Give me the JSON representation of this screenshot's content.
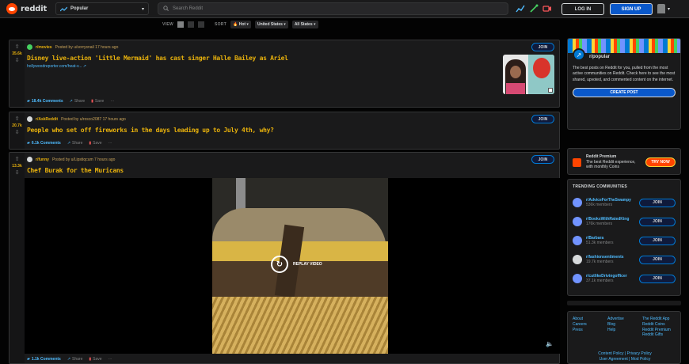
{
  "header": {
    "logo_text": "reddit",
    "feed": "Popular",
    "search_placeholder": "Search Reddit",
    "login_label": "LOG IN",
    "signup_label": "SIGN UP"
  },
  "sortbar": {
    "view_label": "VIEW",
    "sort_label": "SORT",
    "sort_value": "Hot",
    "country": "United States",
    "region": "All States"
  },
  "posts": [
    {
      "score": "35.6k",
      "subreddit": "r/movies",
      "posted_by": "Posted by u/sorrysnail 17 hours ago",
      "title": "Disney live-action 'Little Mermaid' has cast singer Halle Bailey as Ariel",
      "link": "hollywoodreporter.com/heat-v... ↗",
      "comments": "18.4k Comments",
      "share": "Share",
      "save": "Save",
      "join": "JOIN"
    },
    {
      "score": "20.7k",
      "subreddit": "r/AskReddit",
      "posted_by": "Posted by u/rosco2087 17 hours ago",
      "title": "People who set off fireworks in the days leading up to July 4th, why?",
      "comments": "6.1k Comments",
      "share": "Share",
      "save": "Save",
      "join": "JOIN"
    },
    {
      "score": "13.3k",
      "subreddit": "r/funny",
      "posted_by": "Posted by u/Lipstiqcum 7 hours ago",
      "title": "Chef Burak for the Muricans",
      "replay": "REPLAY VIDEO",
      "comments": "1.1k Comments",
      "share": "Share",
      "save": "Save",
      "join": "JOIN"
    }
  ],
  "sidebar": {
    "popular_title": "r/popular",
    "popular_desc": "The best posts on Reddit for you, pulled from the most active communities on Reddit. Check here to see the most shared, upvoted, and commented content on the internet.",
    "create_post": "CREATE POST",
    "premium_title": "Reddit Premium",
    "premium_desc": "The best Reddit experience, with monthly Coins",
    "try_now": "TRY NOW",
    "trending_title": "TRENDING COMMUNITIES",
    "trending": [
      {
        "name": "r/AdviceForTheSwampy",
        "members": "536k members",
        "join": "JOIN"
      },
      {
        "name": "r/BooksWithRatedKing",
        "members": "176k members",
        "join": "JOIN"
      },
      {
        "name": "r/Barbara",
        "members": "51.3k members",
        "join": "JOIN"
      },
      {
        "name": "r/fashionsentiments",
        "members": "19.7k members",
        "join": "JOIN"
      },
      {
        "name": "r/cutlikeDrivingofficer",
        "members": "37.1k members",
        "join": "JOIN"
      }
    ],
    "footer_col1": [
      "About",
      "Careers",
      "Press"
    ],
    "footer_col2": [
      "Advertise",
      "Blog",
      "Help"
    ],
    "footer_col3": [
      "The Reddit App",
      "Reddit Coins",
      "Reddit Premium",
      "Reddit Gifts"
    ],
    "footer_line1": "Content Policy | Privacy Policy",
    "footer_line2": "User Agreement | Mod Policy"
  },
  "colors": {
    "accent": "#0079d3",
    "gold": "#e8b10c",
    "orange": "#ff4500"
  }
}
